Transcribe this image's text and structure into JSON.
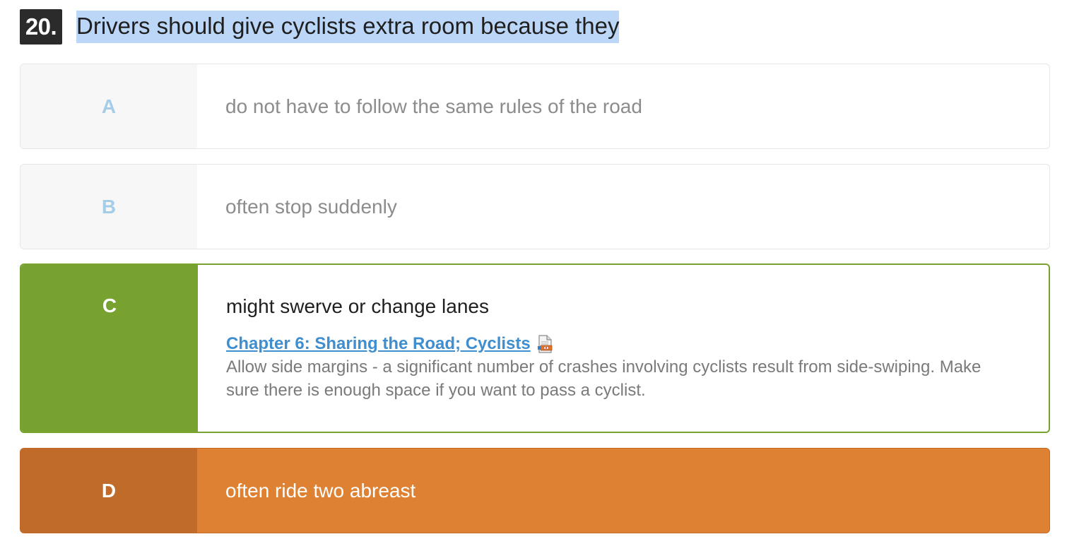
{
  "question": {
    "number": "20.",
    "text": "Drivers should give cyclists extra room because they"
  },
  "answers": [
    {
      "letter": "A",
      "text": "do not have to follow the same rules of the road",
      "state": "unselected"
    },
    {
      "letter": "B",
      "text": "often stop suddenly",
      "state": "unselected"
    },
    {
      "letter": "C",
      "text": "might swerve or change lanes",
      "state": "correct"
    },
    {
      "letter": "D",
      "text": "often ride two abreast",
      "state": "selected-incorrect"
    }
  ],
  "explanation": {
    "link_text": "Chapter 6: Sharing the Road; Cyclists",
    "link_icon": "pdf-document-icon",
    "text": "Allow side margins - a significant number of crashes involving cyclists result from side-swiping. Make sure there is enough space if you want to pass a cyclist."
  },
  "colors": {
    "correct": "#78a22f",
    "incorrect": "#de8132",
    "incorrect_dark": "#c06b29",
    "link": "#3e8ed0",
    "highlight": "#bcd6f7"
  }
}
